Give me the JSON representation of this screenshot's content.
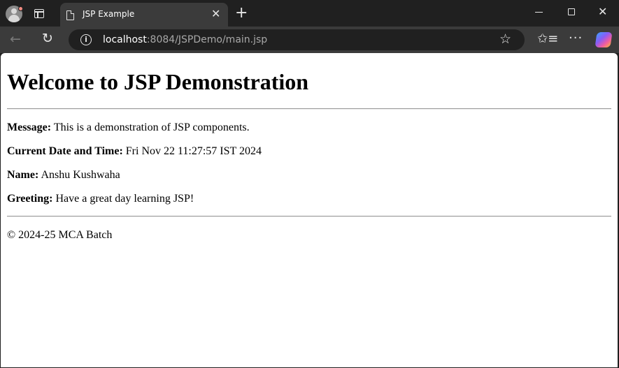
{
  "browser": {
    "tab_title": "JSP Example",
    "tab_close": "✕",
    "new_tab": "+",
    "url_host": "localhost",
    "url_path": ":8084/JSPDemo/main.jsp",
    "icons": {
      "profile": "profile-avatar-icon",
      "tab_actions": "tab-actions-icon",
      "page": "document-icon",
      "back": "back-arrow-icon",
      "reload": "reload-icon",
      "info": "info-icon",
      "favorite": "star-icon",
      "favorites": "favorites-icon",
      "menu": "more-menu-icon",
      "copilot": "copilot-icon",
      "minimize": "minimize-icon",
      "maximize": "maximize-icon",
      "close": "close-icon"
    },
    "glyphs": {
      "back": "←",
      "reload": "↻",
      "info": "i",
      "star": "☆",
      "favorites": "✩≡",
      "menu": "···",
      "close": "✕"
    }
  },
  "page": {
    "heading": "Welcome to JSP Demonstration",
    "message_label": "Message:",
    "message_value": "This is a demonstration of JSP components.",
    "datetime_label": "Current Date and Time:",
    "datetime_value": "Fri Nov 22 11:27:57 IST 2024",
    "name_label": "Name:",
    "name_value": "Anshu Kushwaha",
    "greeting_label": "Greeting:",
    "greeting_value": "Have a great day learning JSP!",
    "footer": "© 2024-25 MCA Batch"
  }
}
